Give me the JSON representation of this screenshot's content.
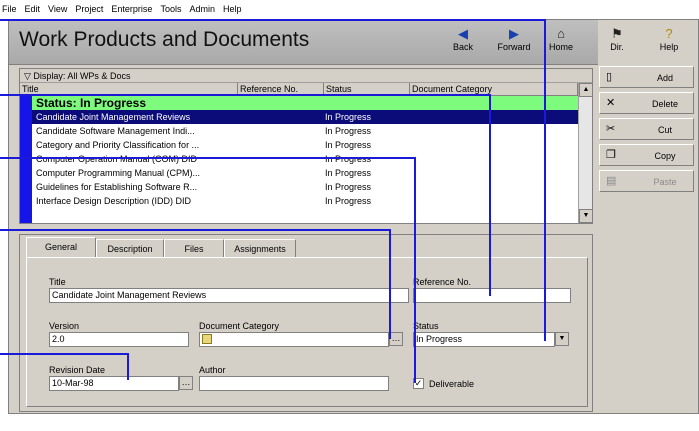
{
  "menu": [
    "File",
    "Edit",
    "View",
    "Project",
    "Enterprise",
    "Tools",
    "Admin",
    "Help"
  ],
  "title": "Work Products and Documents",
  "toolbar": {
    "back": "Back",
    "forward": "Forward",
    "home": "Home",
    "dir": "Dir.",
    "help": "Help"
  },
  "list": {
    "display_label": "Display: All WPs & Docs",
    "columns": [
      "Title",
      "Reference No.",
      "Status",
      "Document Category"
    ],
    "group": "Status: In Progress",
    "rows": [
      {
        "title": "Candidate Joint Management Reviews",
        "status": "In Progress"
      },
      {
        "title": "Candidate Software Management Indi...",
        "status": "In Progress"
      },
      {
        "title": "Category and Priority Classification for ...",
        "status": "In Progress"
      },
      {
        "title": "Computer Operation Manual (COM) DID",
        "status": "In Progress"
      },
      {
        "title": "Computer Programming Manual (CPM)...",
        "status": "In Progress"
      },
      {
        "title": "Guidelines for Establishing Software R...",
        "status": "In Progress"
      },
      {
        "title": "Interface Design Description (IDD) DID",
        "status": "In Progress"
      }
    ]
  },
  "actions": {
    "add": "Add",
    "delete": "Delete",
    "cut": "Cut",
    "copy": "Copy",
    "paste": "Paste"
  },
  "tabs": [
    "General",
    "Description",
    "Files",
    "Assignments"
  ],
  "form": {
    "title_label": "Title",
    "title_value": "Candidate Joint Management Reviews",
    "ref_label": "Reference No.",
    "ref_value": "",
    "version_label": "Version",
    "version_value": "2.0",
    "doccat_label": "Document Category",
    "doccat_value": "",
    "status_label": "Status",
    "status_value": "In Progress",
    "revdate_label": "Revision Date",
    "revdate_value": "10-Mar-98",
    "author_label": "Author",
    "author_value": "",
    "deliverable_label": "Deliverable"
  }
}
